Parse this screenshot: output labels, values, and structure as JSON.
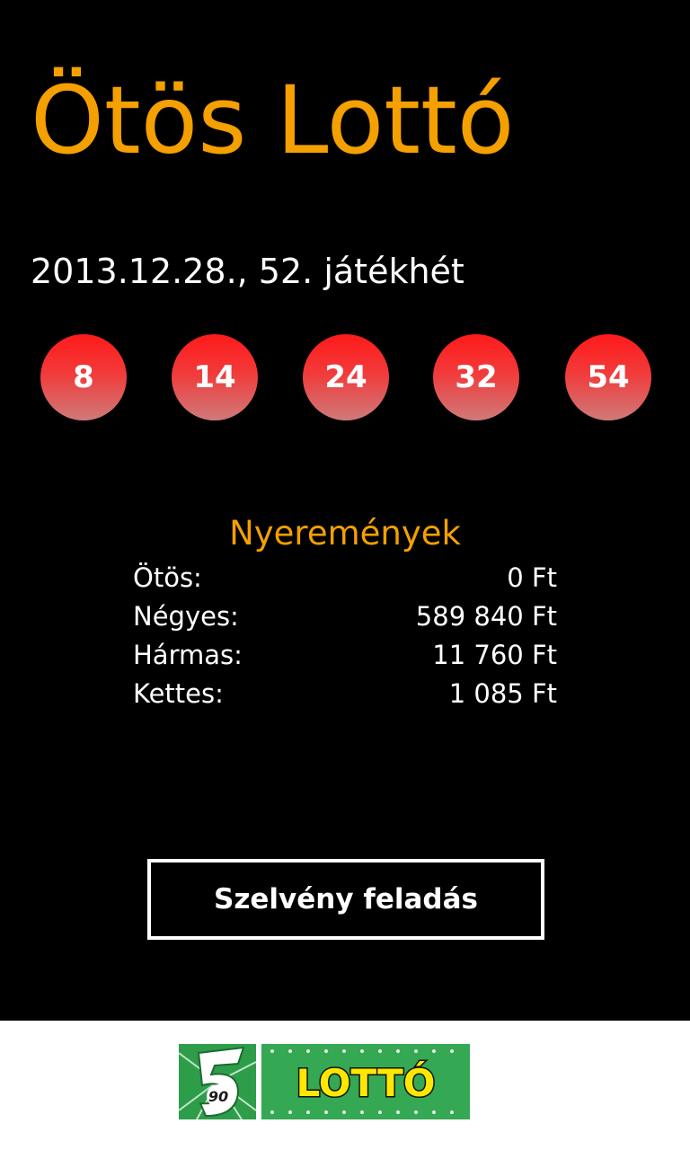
{
  "header": {
    "title": "Ötös Lottó",
    "draw_info": "2013.12.28., 52. játékhét"
  },
  "numbers": [
    "8",
    "14",
    "24",
    "32",
    "54"
  ],
  "prizes": {
    "title": "Nyeremények",
    "rows": [
      {
        "label": "Ötös:",
        "value": "0 Ft"
      },
      {
        "label": "Négyes:",
        "value": "589 840 Ft"
      },
      {
        "label": "Hármas:",
        "value": "11 760 Ft"
      },
      {
        "label": "Kettes:",
        "value": "1 085 Ft"
      }
    ]
  },
  "actions": {
    "submit_label": "Szelvény feladás"
  },
  "footer": {
    "logo_text": "LOTTÓ",
    "logo_number": "90"
  },
  "colors": {
    "accent": "#f4a000",
    "ball": "#ff1a1a",
    "logo_green": "#2e9d4a",
    "logo_yellow": "#ffe800"
  }
}
